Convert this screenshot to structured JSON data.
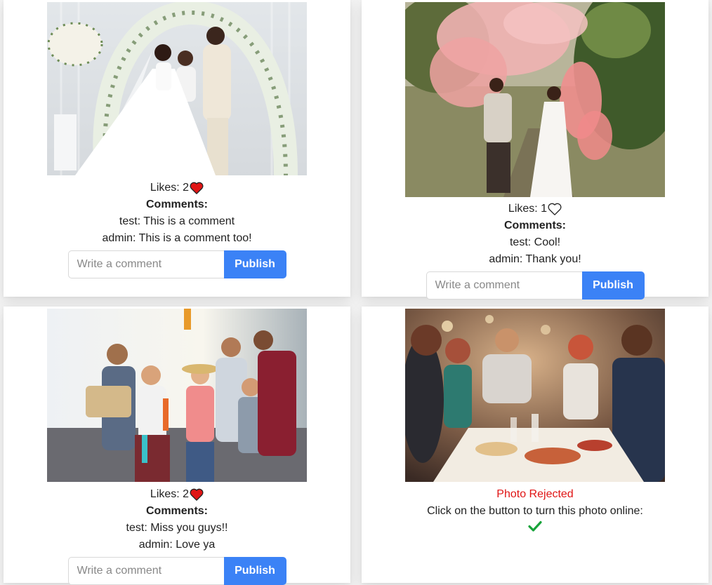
{
  "colors": {
    "accent": "#3b82f6",
    "heart_red": "#e01515",
    "rejected": "#e01515",
    "check_green": "#17a33a"
  },
  "posts": [
    {
      "likes_label": "Likes: 2",
      "liked": true,
      "comments_title": "Comments:",
      "comments": [
        "test: This is a comment",
        "admin: This is a comment too!"
      ],
      "comment_placeholder": "Write a comment",
      "publish_label": "Publish"
    },
    {
      "likes_label": "Likes: 1",
      "liked": false,
      "comments_title": "Comments:",
      "comments": [
        "test: Cool!",
        "admin: Thank you!"
      ],
      "comment_placeholder": "Write a comment",
      "publish_label": "Publish"
    },
    {
      "likes_label": "Likes: 2",
      "liked": true,
      "comments_title": "Comments:",
      "comments": [
        "test: Miss you guys!!",
        "admin: Love ya"
      ],
      "comment_placeholder": "Write a comment",
      "publish_label": "Publish"
    },
    {
      "status_label": "Photo Rejected",
      "status_message": "Click on the button to turn this photo online:",
      "approve_icon": "check-icon"
    }
  ]
}
